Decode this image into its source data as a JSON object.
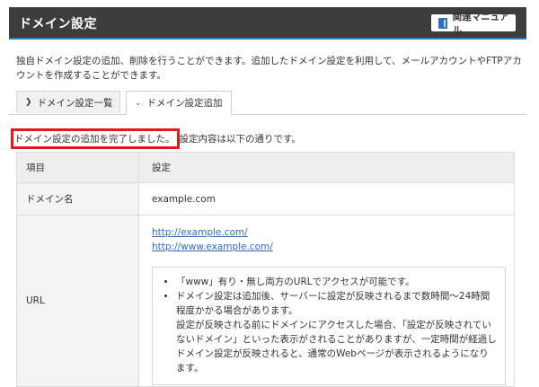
{
  "header": {
    "title": "ドメイン設定",
    "manual_label": "関連マニュアル"
  },
  "description": "独自ドメイン設定の追加、削除を行うことができます。追加したドメイン設定を利用して、メールアカウントやFTPアカウントを作成することができます。",
  "tabs": [
    {
      "label": "ドメイン設定一覧",
      "active": false
    },
    {
      "label": "ドメイン設定追加",
      "active": true
    }
  ],
  "notice": {
    "highlight": "ドメイン設定の追加を完了しました。",
    "rest": "設定内容は以下の通りです。"
  },
  "table": {
    "headers": [
      "項目",
      "設定"
    ],
    "rows": {
      "domain": {
        "label": "ドメイン名",
        "value": "example.com"
      },
      "url": {
        "label": "URL",
        "links": [
          "http://example.com/",
          "http://www.example.com/"
        ],
        "notes": [
          "「www」有り・無し両方のURLでアクセスが可能です。",
          "ドメイン設定は追加後、サーバーに設定が反映されるまで数時間〜24時間程度かかる場合があります。\n設定が反映される前にドメインにアクセスした場合、「設定が反映されていないドメイン」といった表示がされることがありますが、一定時間が経過しドメイン設定が反映されると、通常のWebページが表示されるようになります。"
        ]
      }
    }
  },
  "colors": {
    "header_bg": "#3d3d3d",
    "accent": "#2f7cc0",
    "link": "#2f6fb4",
    "highlight_border": "#e01919"
  }
}
